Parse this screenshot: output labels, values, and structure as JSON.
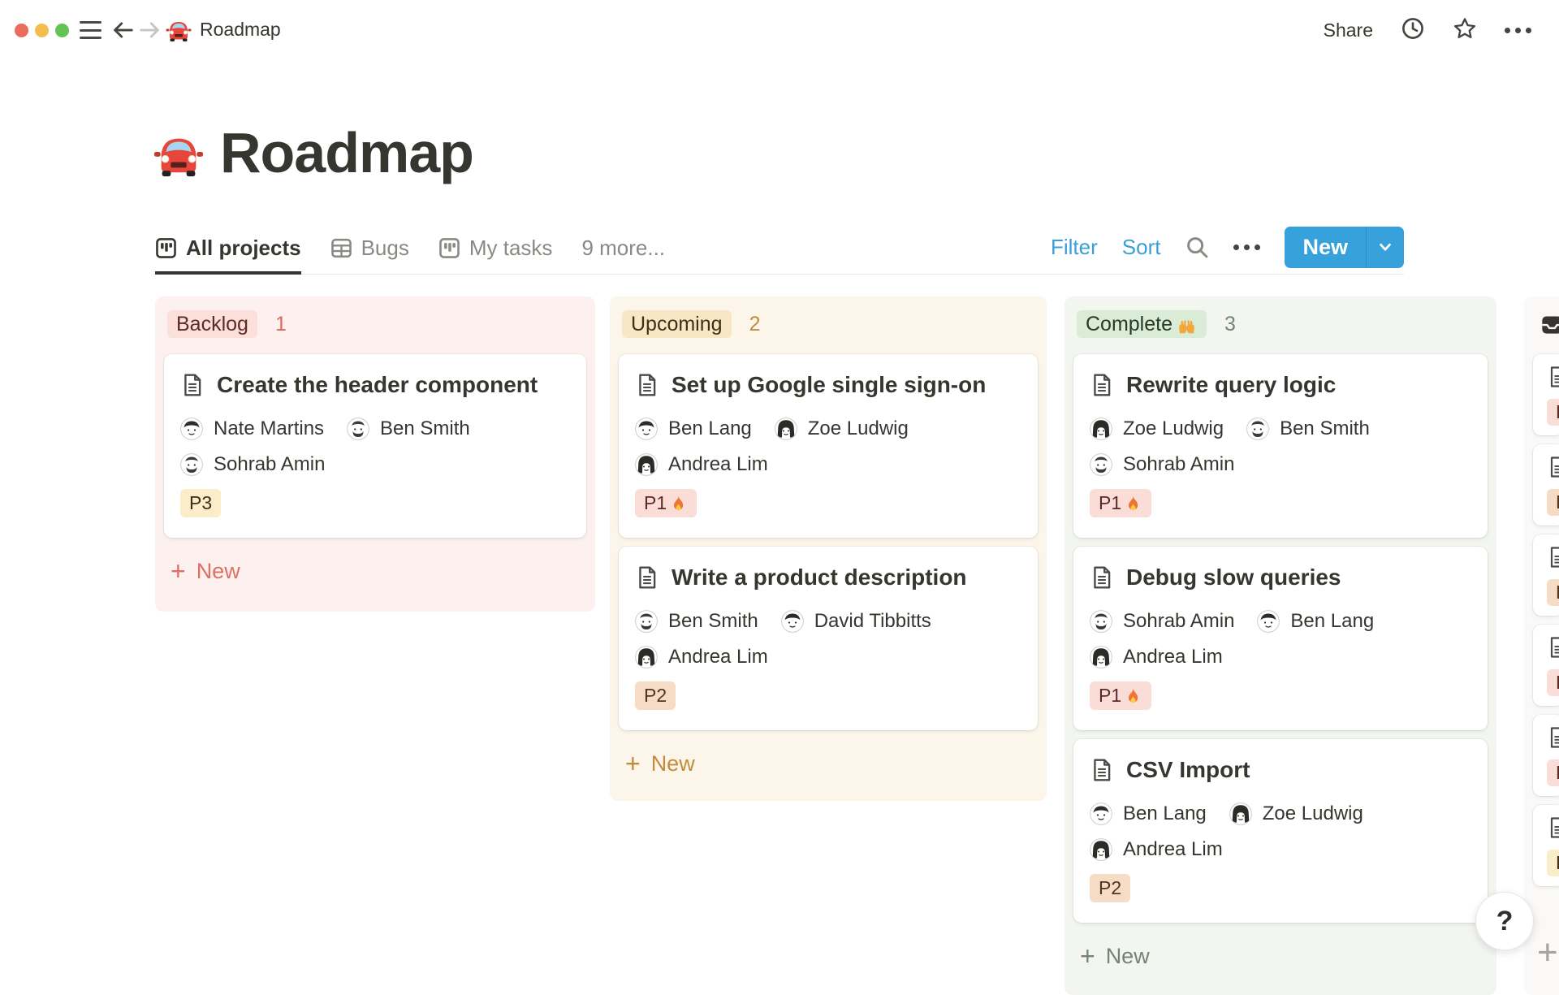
{
  "topbar": {
    "breadcrumb_label": "Roadmap",
    "share_label": "Share"
  },
  "page": {
    "title": "Roadmap",
    "icon": "car-icon"
  },
  "view_tabs": [
    {
      "label": "All projects",
      "icon": "board-view-icon",
      "active": true
    },
    {
      "label": "Bugs",
      "icon": "table-view-icon",
      "active": false
    },
    {
      "label": "My tasks",
      "icon": "board-view-icon",
      "active": false
    },
    {
      "label": "9 more...",
      "icon": null,
      "active": false
    }
  ],
  "view_controls": {
    "filter_label": "Filter",
    "sort_label": "Sort",
    "new_label": "New",
    "accent_blue": "#36A1DB",
    "link_blue": "#3A9FD9"
  },
  "board": {
    "columns": [
      {
        "name": "Backlog",
        "count": "1",
        "theme": "red",
        "new_label": "New",
        "cards": [
          {
            "title": "Create the header component",
            "assignees": [
              "Nate Martins",
              "Ben Smith",
              "Sohrab Amin"
            ],
            "priority": {
              "label": "P3",
              "theme": "yellow",
              "fire": false
            }
          }
        ]
      },
      {
        "name": "Upcoming",
        "count": "2",
        "theme": "yellow",
        "new_label": "New",
        "cards": [
          {
            "title": "Set up Google single sign-on",
            "assignees": [
              "Ben Lang",
              "Zoe Ludwig",
              "Andrea Lim"
            ],
            "priority": {
              "label": "P1",
              "theme": "red",
              "fire": true
            }
          },
          {
            "title": "Write a product description",
            "assignees": [
              "Ben Smith",
              "David Tibbitts",
              "Andrea Lim"
            ],
            "priority": {
              "label": "P2",
              "theme": "orange",
              "fire": false
            }
          }
        ]
      },
      {
        "name": "Complete",
        "name_icon": "raised-hands-icon",
        "count": "3",
        "theme": "green",
        "new_label": "New",
        "cards": [
          {
            "title": "Rewrite query logic",
            "assignees": [
              "Zoe Ludwig",
              "Ben Smith",
              "Sohrab Amin"
            ],
            "priority": {
              "label": "P1",
              "theme": "red",
              "fire": true
            }
          },
          {
            "title": "Debug slow queries",
            "assignees": [
              "Sohrab Amin",
              "Ben Lang",
              "Andrea Lim"
            ],
            "priority": {
              "label": "P1",
              "theme": "red",
              "fire": true
            }
          },
          {
            "title": "CSV Import",
            "assignees": [
              "Ben Lang",
              "Zoe Ludwig",
              "Andrea Lim"
            ],
            "priority": {
              "label": "P2",
              "theme": "orange",
              "fire": false
            }
          }
        ]
      }
    ],
    "partial_column": {
      "header_icon": "inbox-icon",
      "partial_badge_label": "P",
      "stub_badges": [
        "red",
        "orange",
        "orange",
        "red",
        "red",
        "yellow"
      ]
    }
  },
  "help_button_label": "?",
  "colors": {
    "backlog_bg": "#FDF1EF",
    "upcoming_bg": "#FBF5EA",
    "complete_bg": "#F2F5F0",
    "badge_red": "#FBDFDB",
    "badge_yellow": "#F8E7C4",
    "badge_green": "#DAEBD6",
    "p1_bg": "#FBDDD8",
    "p2_bg": "#F6DCC4",
    "p3_bg": "#FBEDC9",
    "accent_red": "#DE6F62",
    "accent_gold": "#BF8D3C",
    "accent_green": "#748472",
    "text_dark": "#37352F",
    "text_gray": "#8A8983"
  }
}
